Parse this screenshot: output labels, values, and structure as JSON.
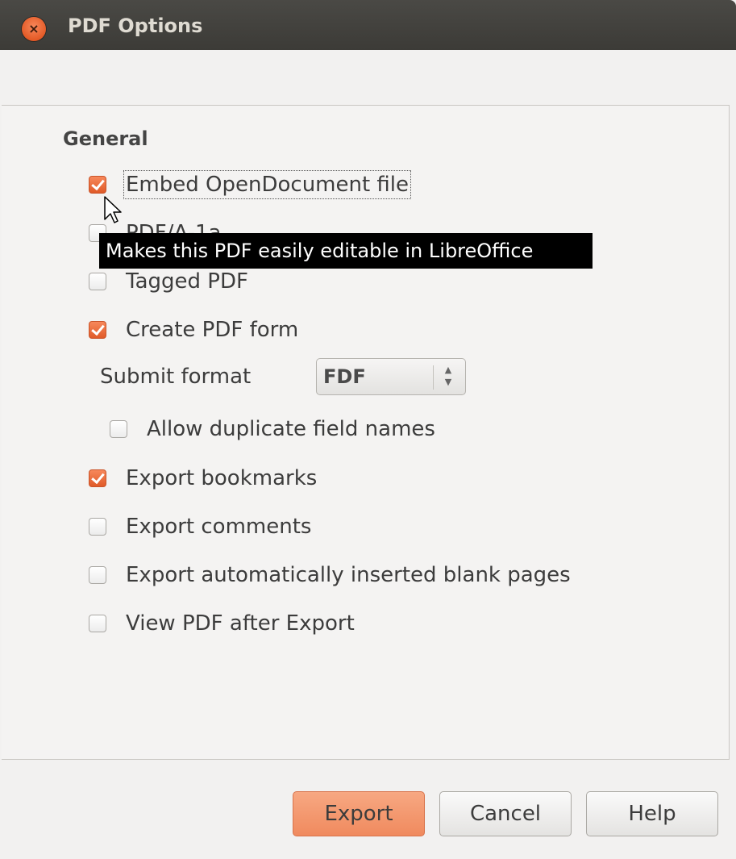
{
  "window": {
    "title": "PDF Options"
  },
  "general": {
    "section_title": "General",
    "options": [
      {
        "label": "Embed OpenDocument file",
        "checked": true
      },
      {
        "label": "PDF/A-1a",
        "checked": false
      },
      {
        "label": "Tagged PDF",
        "checked": false
      },
      {
        "label": "Create PDF form",
        "checked": true
      }
    ],
    "submit_format": {
      "label": "Submit format",
      "value": "FDF"
    },
    "allow_duplicate": {
      "label": "Allow duplicate field names",
      "checked": false
    },
    "options2": [
      {
        "label": "Export bookmarks",
        "checked": true
      },
      {
        "label": "Export comments",
        "checked": false
      },
      {
        "label": "Export automatically inserted blank pages",
        "checked": false
      },
      {
        "label": "View PDF after Export",
        "checked": false
      }
    ]
  },
  "tooltip": "Makes this PDF easily editable in LibreOffice",
  "buttons": {
    "export": "Export",
    "cancel": "Cancel",
    "help": "Help"
  },
  "colors": {
    "accent": "#f08a5e",
    "titlebar": "#3c3b37"
  }
}
